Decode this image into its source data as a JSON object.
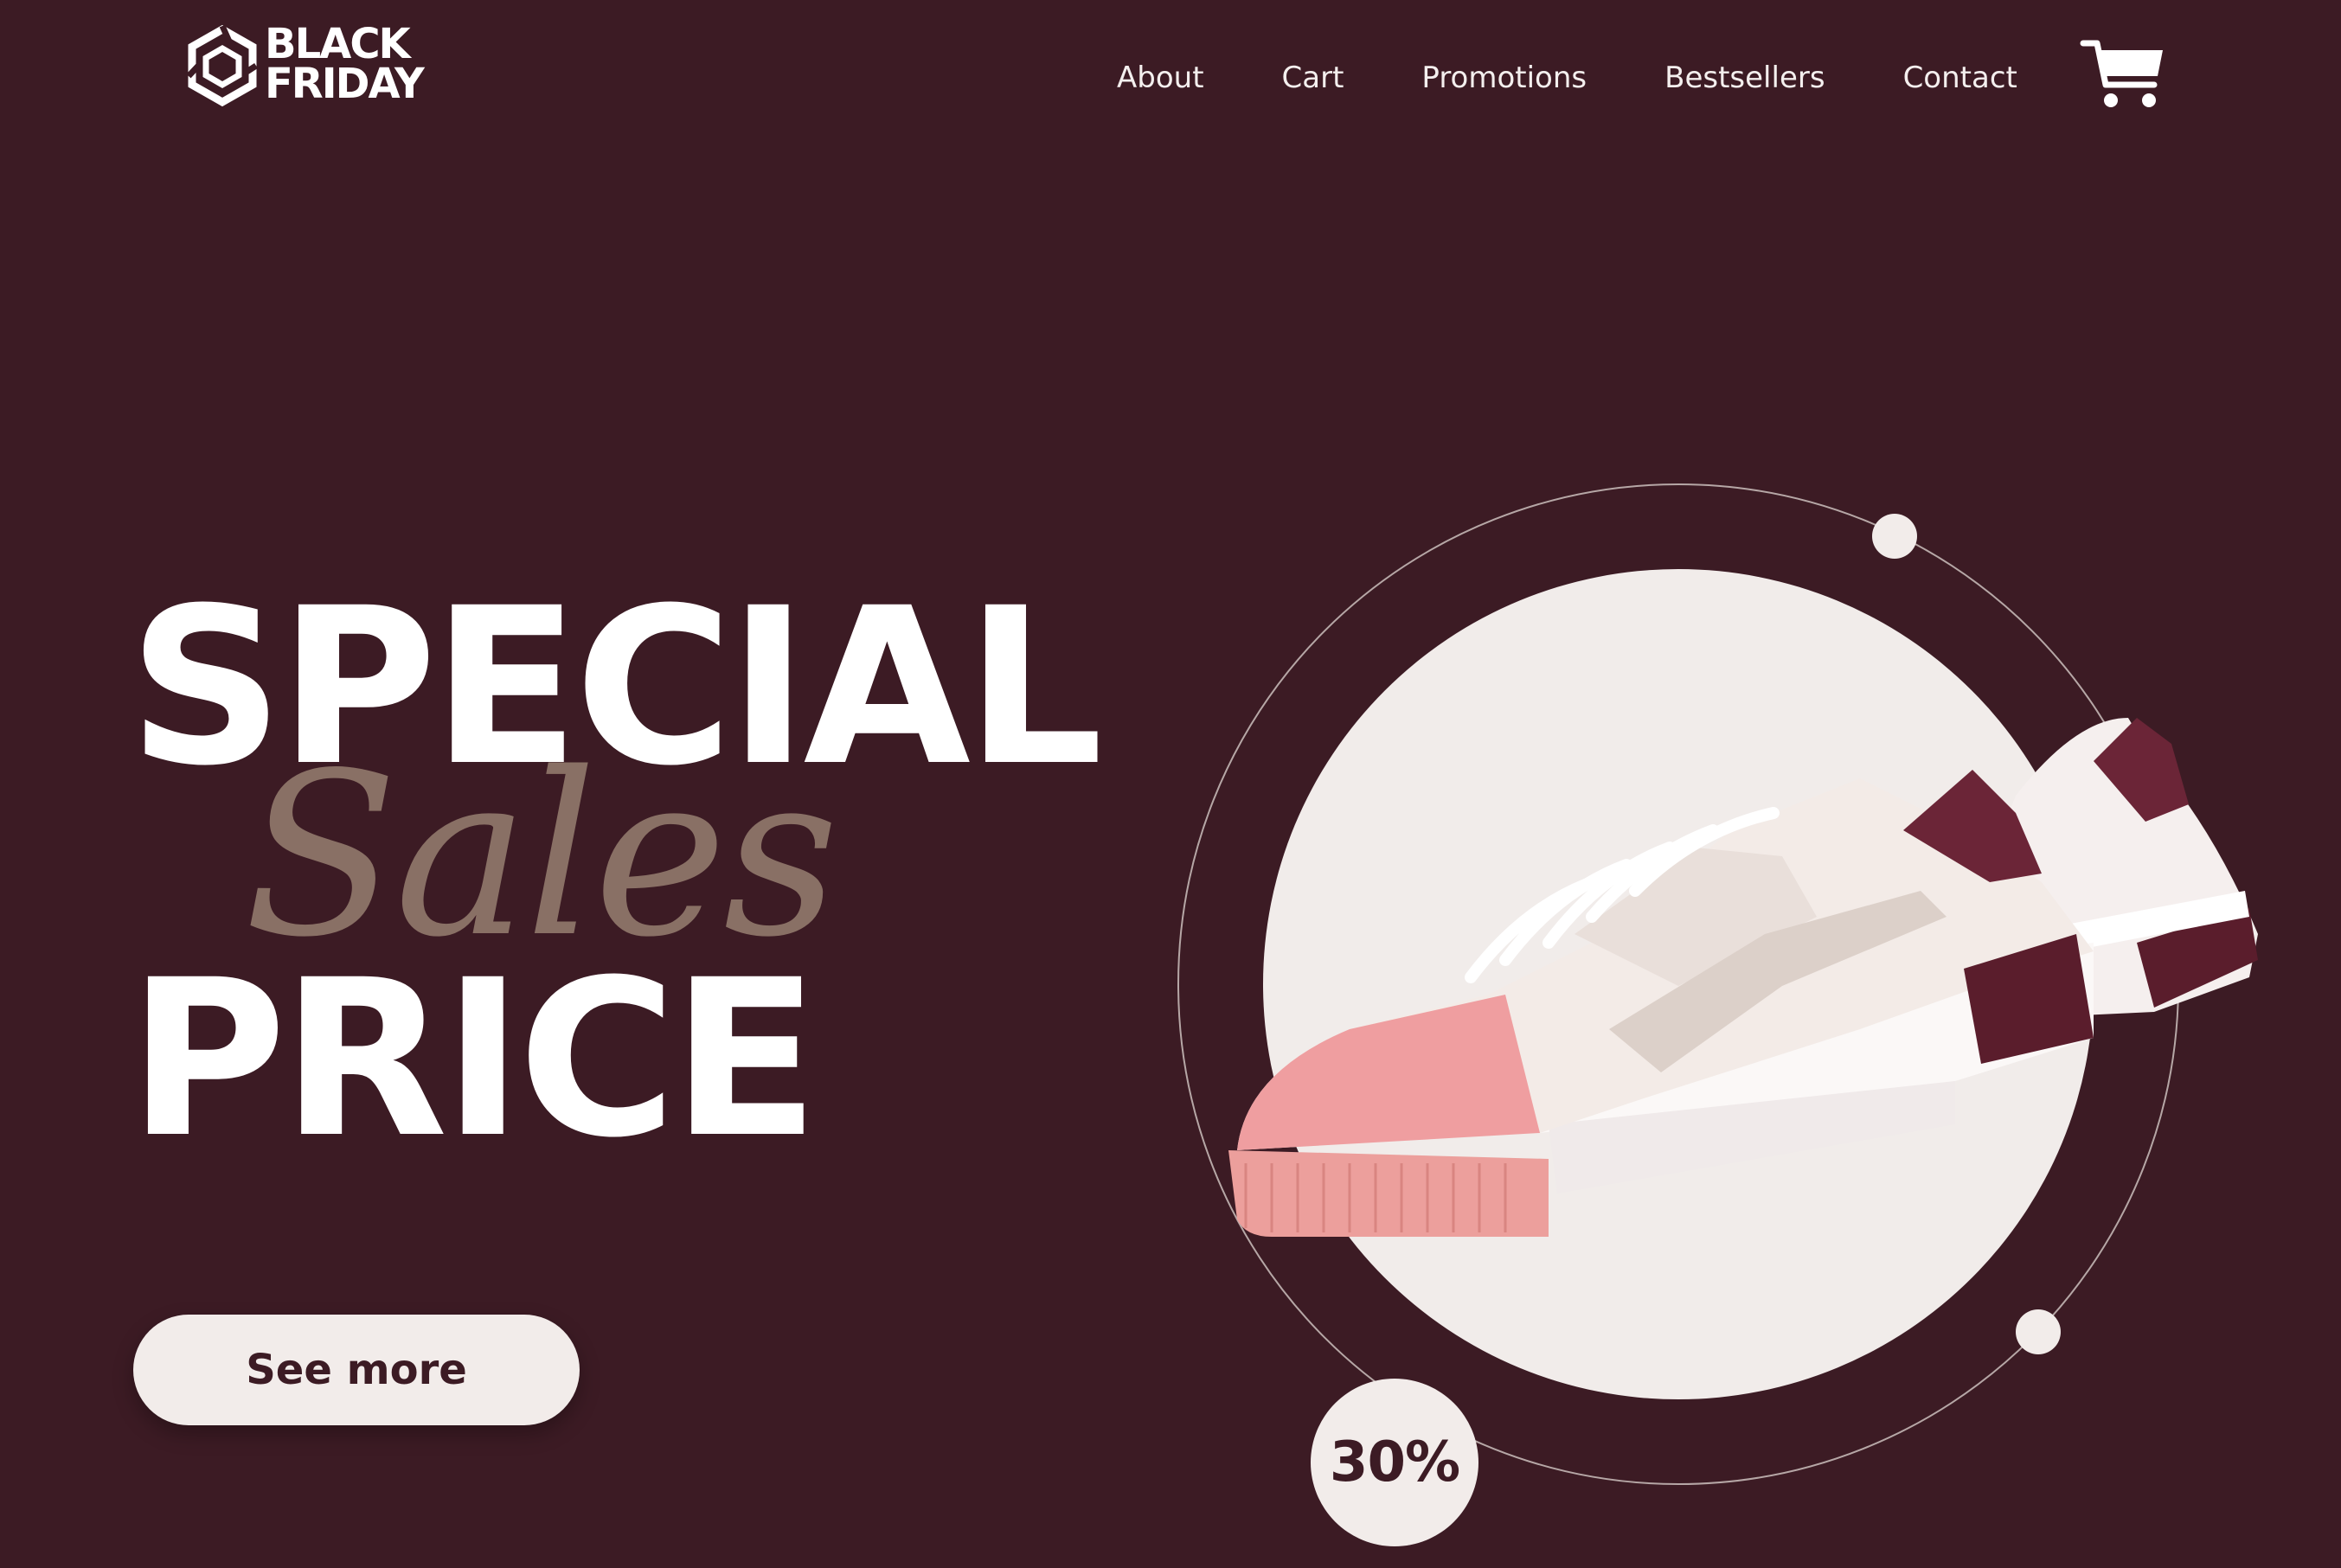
{
  "brand": {
    "line1": "BLACK",
    "line2": "FRIDAY"
  },
  "nav": {
    "items": [
      {
        "label": "About"
      },
      {
        "label": "Cart"
      },
      {
        "label": "Promotions"
      },
      {
        "label": "Bestsellers"
      },
      {
        "label": "Contact"
      }
    ],
    "cart_icon": "shopping-cart-icon"
  },
  "hero": {
    "word1": "SPECIAL",
    "word2": "Sales",
    "word3": "PRICE",
    "cta_label": "See more",
    "discount": "30%",
    "product_image": "sneaker-image"
  },
  "colors": {
    "background": "#3c1b24",
    "light": "#f2ecea",
    "accent_script": "#8d7468",
    "text": "#ffffff"
  }
}
